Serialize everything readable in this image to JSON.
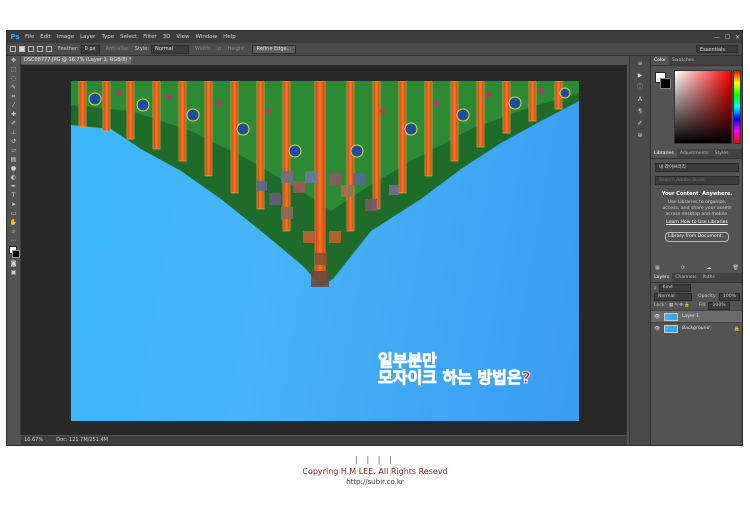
{
  "app": {
    "logo": "Ps",
    "menu": [
      "File",
      "Edit",
      "Image",
      "Layer",
      "Type",
      "Select",
      "Filter",
      "3D",
      "View",
      "Window",
      "Help"
    ],
    "window_controls": [
      "—",
      "☐",
      "✕"
    ]
  },
  "options": {
    "feather_label": "Feather:",
    "feather_value": "0 px",
    "antialias_label": "Anti-alias",
    "style_label": "Style:",
    "style_value": "Normal",
    "width_label": "Width:",
    "height_label": "Height:",
    "refine_label": "Refine Edge...",
    "workspace": "Essentials"
  },
  "document": {
    "tab_label": "DSC08777.JPG @ 16.7% (Layer 1, RGB/8) *",
    "overlay_line1": "일부분만",
    "overlay_line2": "모자이크 하는 방법은?"
  },
  "status": {
    "zoom": "16.67%",
    "doc_size": "Doc: 121.7M/251.4M"
  },
  "color_panel": {
    "tabs": [
      "Color",
      "Swatches"
    ],
    "foreground": "#ffffff",
    "background": "#000000"
  },
  "libraries_panel": {
    "tabs": [
      "Libraries",
      "Adjustments",
      "Styles"
    ],
    "library_select": "내 라이브러리",
    "search_placeholder": "Search Adobe Stock",
    "heading": "Your Content. Anywhere.",
    "text": "Use Libraries to organize, access, and share your assets across desktop and mobile.",
    "link": "Learn How to Use Libraries",
    "button": "Library from Document..."
  },
  "layers_panel": {
    "tabs": [
      "Layers",
      "Channels",
      "Paths"
    ],
    "kind_label": "Kind",
    "blend_mode": "Normal",
    "opacity_label": "Opacity:",
    "opacity_value": "100%",
    "lock_label": "Lock:",
    "fill_label": "Fill:",
    "fill_value": "100%",
    "layers": [
      {
        "name": "Layer 1"
      },
      {
        "name": "Background"
      }
    ]
  },
  "footer": {
    "bars": "| | | |",
    "copyright": "Copyring H.M LEE. All Rights Resevd",
    "url": "http://subir.co.kr"
  }
}
